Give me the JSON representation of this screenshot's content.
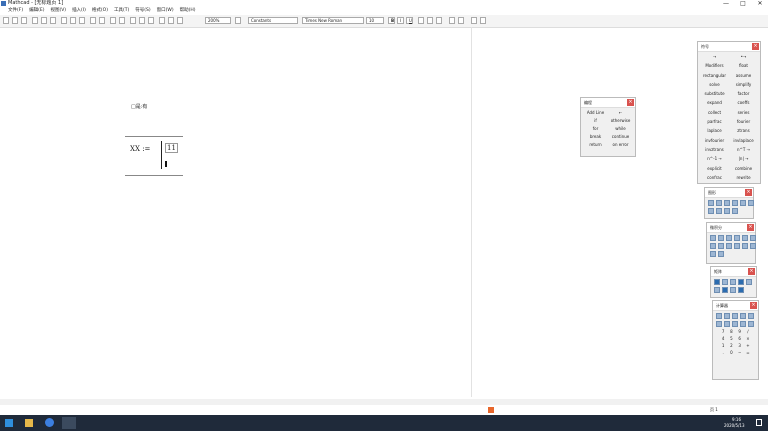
{
  "window": {
    "title": "Mathcad - [无标题页 1]",
    "min": "—",
    "max": "□",
    "close": "✕"
  },
  "menu": [
    "文件(F)",
    "编辑(E)",
    "视图(V)",
    "插入(I)",
    "格式(O)",
    "工具(T)",
    "符号(S)",
    "窗口(W)",
    "帮助(H)"
  ],
  "toolbar": {
    "zoom": "200%",
    "style": "Constants",
    "font": "Times New Roman",
    "size": "10",
    "bold": "B",
    "italic": "I",
    "underline": "U"
  },
  "worksheet": {
    "placeholder": "□是:有",
    "lhs": "XX :=",
    "cell": "11"
  },
  "program_palette": {
    "title": "编程",
    "items": [
      "Add Line",
      "←",
      "if",
      "otherwise",
      "for",
      "while",
      "break",
      "continue",
      "return",
      "on error"
    ]
  },
  "symbolic_palette": {
    "title": "符号",
    "items": [
      "→",
      "•→",
      "Modifiers",
      "float",
      "rectangular",
      "assume",
      "solve",
      "simplify",
      "substitute",
      "factor",
      "expand",
      "coeffs",
      "collect",
      "series",
      "parfrac",
      "fourier",
      "laplace",
      "ztrans",
      "invfourier",
      "invlaplace",
      "invztrans",
      "n^T →",
      "n^-1 →",
      "|n| →",
      "explicit",
      "combine",
      "confrac",
      "rewrite"
    ]
  },
  "graph_palette": {
    "title": "图形"
  },
  "calculus_palette": {
    "title": "微积分"
  },
  "matrix_palette": {
    "title": "矩阵"
  },
  "calculator_palette": {
    "title": "计算器",
    "items": [
      "7",
      "8",
      "9",
      "/",
      "4",
      "5",
      "6",
      "×",
      "1",
      "2",
      "3",
      "+",
      ".",
      "0",
      "−",
      "="
    ]
  },
  "status": {
    "page": "页 1"
  },
  "taskbar": {
    "time": "9:16",
    "date": "2020/5/13"
  }
}
